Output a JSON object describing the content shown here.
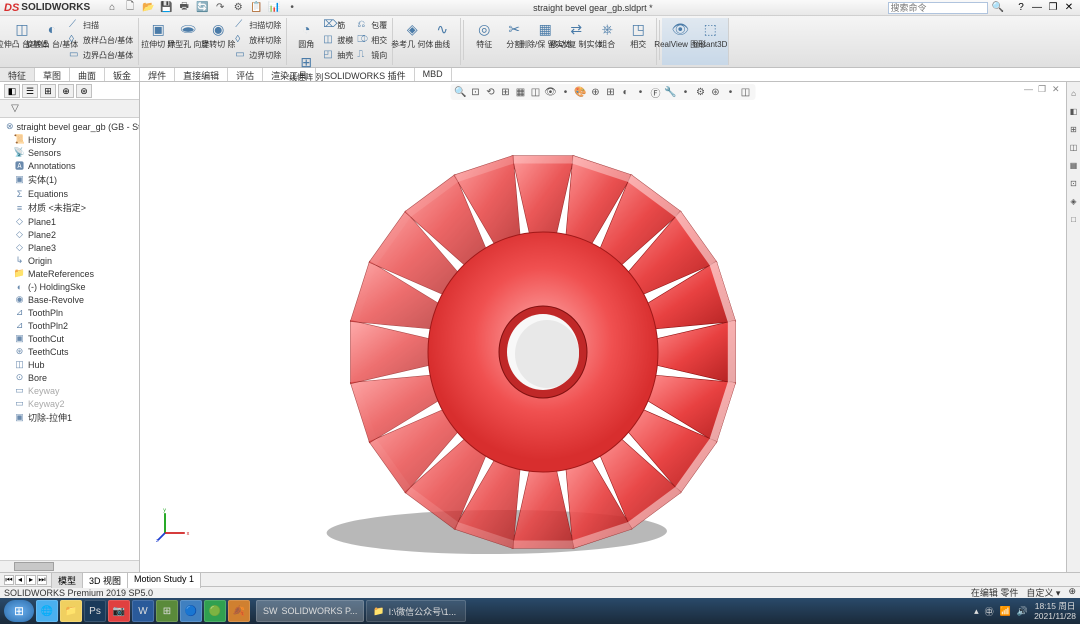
{
  "app": {
    "brand_logo": "DS",
    "brand_name": "SOLIDWORKS",
    "doc_title": "straight bevel gear_gb.sldprt *",
    "search_placeholder": "搜索命令"
  },
  "win": {
    "help": "?",
    "min": "—",
    "max": "❐",
    "close": "✕"
  },
  "qat": [
    "⌂",
    "🗋",
    "📂",
    "💾",
    "🖶",
    "🔄",
    "↷",
    "⚙",
    "📋",
    "📊",
    "•"
  ],
  "ribbon": {
    "g1_big": {
      "icon": "◫",
      "label": "拉伸凸\n台/基体"
    },
    "g1_big2": {
      "icon": "◐",
      "label": "旋转凸\n台/基体"
    },
    "g1_rows": [
      {
        "icon": "⟋",
        "label": "扫描"
      },
      {
        "icon": "◊",
        "label": "放样凸台/基体"
      },
      {
        "icon": "▭",
        "label": "边界凸台/基体"
      }
    ],
    "g2_big": {
      "icon": "▣",
      "label": "拉伸切\n除"
    },
    "g2_big2": {
      "icon": "🕳",
      "label": "异型孔\n向导"
    },
    "g2_big3": {
      "icon": "◉",
      "label": "旋转切\n除"
    },
    "g2_rows": [
      {
        "icon": "⟋",
        "label": "扫描切除"
      },
      {
        "icon": "◊",
        "label": "放样切除"
      },
      {
        "icon": "▭",
        "label": "边界切除"
      }
    ],
    "g3_rows_a": [
      {
        "icon": "◔",
        "label": "圆角"
      },
      {
        "icon": "⊞",
        "label": "线性阵\n列"
      }
    ],
    "g3_rows_b": [
      {
        "icon": "⌦",
        "label": "筋"
      },
      {
        "icon": "◫",
        "label": "拔模"
      },
      {
        "icon": "◰",
        "label": "抽壳"
      }
    ],
    "g3_rows_c": [
      {
        "icon": "⎌",
        "label": "包覆"
      },
      {
        "icon": "⎄",
        "label": "相交"
      },
      {
        "icon": "⎍",
        "label": "镜向"
      }
    ],
    "g4_big": {
      "icon": "◈",
      "label": "参考几\n何体"
    },
    "g4_big2": {
      "icon": "∿",
      "label": "曲线"
    },
    "g5_big": {
      "icon": "◎",
      "label": "特征"
    },
    "g5_rows": [
      {
        "icon": "✂",
        "label": "分割"
      },
      {
        "icon": "▦",
        "label": "删除/保\n留实体"
      },
      {
        "icon": "⇄",
        "label": "移动/复\n制实体"
      },
      {
        "icon": "⎈",
        "label": "组合"
      },
      {
        "icon": "◳",
        "label": "相交"
      }
    ],
    "g6_big": {
      "icon": "👁",
      "label": "RealView\n图形"
    },
    "g6_big2": {
      "icon": "⬚",
      "label": "Instant3D"
    }
  },
  "tabs": [
    "特征",
    "草图",
    "曲面",
    "钣金",
    "焊件",
    "直接编辑",
    "评估",
    "渲染工具",
    "SOLIDWORKS 插件",
    "MBD"
  ],
  "active_tab": 0,
  "panel_tabs_icons": [
    "◧",
    "☰",
    "⊞",
    "⊕",
    "⊛"
  ],
  "tree_root": "straight bevel gear_gb  (GB - Straigh",
  "tree": [
    {
      "icon": "📜",
      "label": "History"
    },
    {
      "icon": "📡",
      "label": "Sensors"
    },
    {
      "icon": "🅰",
      "label": "Annotations"
    },
    {
      "icon": "▣",
      "label": "实体(1)"
    },
    {
      "icon": "Σ",
      "label": "Equations"
    },
    {
      "icon": "≡",
      "label": "材质 <未指定>"
    },
    {
      "icon": "◇",
      "label": "Plane1"
    },
    {
      "icon": "◇",
      "label": "Plane2"
    },
    {
      "icon": "◇",
      "label": "Plane3"
    },
    {
      "icon": "↳",
      "label": "Origin"
    },
    {
      "icon": "📁",
      "label": "MateReferences"
    },
    {
      "icon": "◐",
      "label": "(-) HoldingSke"
    },
    {
      "icon": "◉",
      "label": "Base-Revolve"
    },
    {
      "icon": "⊿",
      "label": "ToothPln"
    },
    {
      "icon": "⊿",
      "label": "ToothPln2"
    },
    {
      "icon": "▣",
      "label": "ToothCut"
    },
    {
      "icon": "⊛",
      "label": "TeethCuts"
    },
    {
      "icon": "◫",
      "label": "Hub"
    },
    {
      "icon": "⊙",
      "label": "Bore"
    },
    {
      "icon": "▭",
      "label": "Keyway",
      "dim": true
    },
    {
      "icon": "▭",
      "label": "Keyway2",
      "dim": true
    },
    {
      "icon": "▣",
      "label": "切除-拉伸1"
    }
  ],
  "view_toolbar": [
    "🔍",
    "⊡",
    "⟲",
    "⊞",
    "▦",
    "◫",
    "👁",
    "•",
    "🎨",
    "⊕",
    "⊞",
    "◐",
    "•",
    "Ⓕ",
    "🔧",
    "•",
    "⚙",
    "⊛",
    "•",
    "◫"
  ],
  "right_sidebar": [
    "⌂",
    "◧",
    "⊞",
    "◫",
    "▦",
    "⊡",
    "◈",
    "□"
  ],
  "bottom_tabs": [
    "模型",
    "3D 视图",
    "Motion Study 1"
  ],
  "active_bottom_tab": 0,
  "status_left": "SOLIDWORKS Premium 2019 SP5.0",
  "status_right": {
    "a": "在编辑 零件",
    "b": "自定义 ▾",
    "c": "⊕"
  },
  "taskbar": {
    "pinned": [
      {
        "icon": "🌐",
        "color": "#4ab0f0"
      },
      {
        "icon": "📁",
        "color": "#f0d060"
      },
      {
        "icon": "Ps",
        "color": "#1a3a5a"
      },
      {
        "icon": "📷",
        "color": "#e04040"
      },
      {
        "icon": "W",
        "color": "#2a5a9a"
      },
      {
        "icon": "⊞",
        "color": "#5a8a3a"
      },
      {
        "icon": "🔵",
        "color": "#4080c0"
      },
      {
        "icon": "🟢",
        "color": "#30a050"
      },
      {
        "icon": "🍂",
        "color": "#d08030"
      }
    ],
    "running": [
      {
        "icon": "SW",
        "label": "SOLIDWORKS P...",
        "active": true
      },
      {
        "icon": "📁",
        "label": "I:\\微信公众号\\1..."
      }
    ],
    "time": "18:15 周日",
    "date": "2021/11/28"
  }
}
